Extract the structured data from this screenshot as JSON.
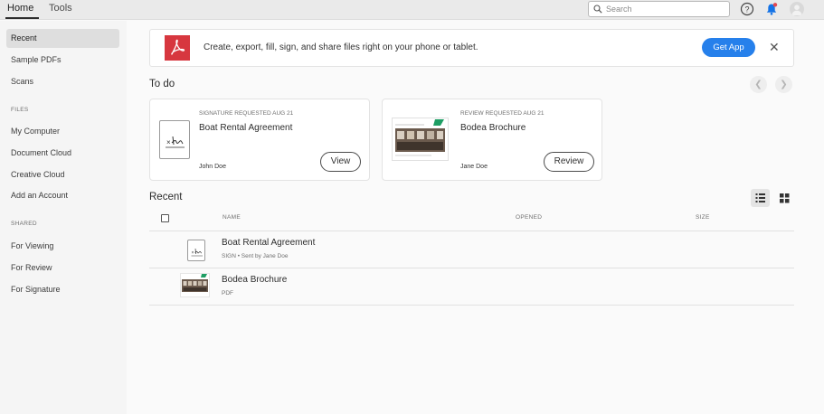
{
  "topbar": {
    "tabs": [
      {
        "label": "Home",
        "active": true
      },
      {
        "label": "Tools",
        "active": false
      }
    ],
    "search": {
      "placeholder": "Search",
      "value": ""
    }
  },
  "sidebar": {
    "items_top": [
      {
        "label": "Recent",
        "selected": true
      },
      {
        "label": "Sample PDFs",
        "selected": false
      },
      {
        "label": "Scans",
        "selected": false
      }
    ],
    "files_header": "FILES",
    "files_items": [
      "My Computer",
      "Document Cloud",
      "Creative Cloud",
      "Add an Account"
    ],
    "shared_header": "SHARED",
    "shared_items": [
      "For Viewing",
      "For Review",
      "For Signature"
    ]
  },
  "banner": {
    "text": "Create, export, fill, sign, and share files right on your phone or tablet.",
    "button": "Get App",
    "close": "✕",
    "logo_color": "#d7373f",
    "button_color": "#2680eb"
  },
  "todo": {
    "title": "To do",
    "cards": [
      {
        "status": "SIGNATURE REQUESTED AUG 21",
        "title": "Boat Rental Agreement",
        "user": "John Doe",
        "button": "View"
      },
      {
        "status": "REVIEW REQUESTED AUG 21",
        "title": "Bodea Brochure",
        "user": "Jane Doe",
        "button": "Review"
      }
    ]
  },
  "recent": {
    "title": "Recent",
    "columns": {
      "name": "NAME",
      "opened": "OPENED",
      "size": "SIZE"
    },
    "rows": [
      {
        "title": "Boat Rental Agreement",
        "subtitle": "SIGN • Sent by Jane Doe"
      },
      {
        "title": "Bodea Brochure",
        "subtitle": "PDF"
      }
    ]
  }
}
